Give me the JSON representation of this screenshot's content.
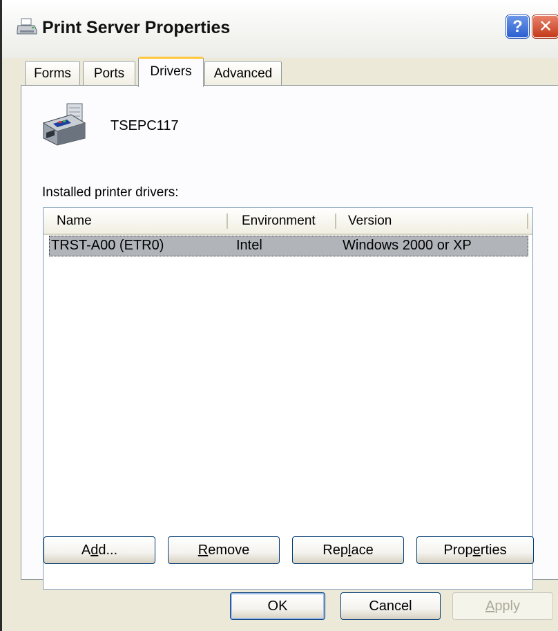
{
  "window": {
    "title": "Print Server Properties",
    "help_label": "?",
    "close_label": "✕",
    "accent": "#2a5fd1",
    "close_color": "#c33a1a"
  },
  "tabs": [
    {
      "label": "Forms",
      "selected": false
    },
    {
      "label": "Ports",
      "selected": false
    },
    {
      "label": "Drivers",
      "selected": true
    },
    {
      "label": "Advanced",
      "selected": false
    }
  ],
  "drivers_page": {
    "server_name": "TSEPC117",
    "installed_label": "Installed printer drivers:",
    "columns": [
      "Name",
      "Environment",
      "Version"
    ],
    "rows": [
      {
        "name": "TRST-A00 (ETR0)",
        "environment": "Intel",
        "version": "Windows 2000 or XP",
        "selected": true
      }
    ],
    "buttons": {
      "add": {
        "pre": "A",
        "key": "d",
        "post": "d..."
      },
      "remove": {
        "pre": "",
        "key": "R",
        "post": "emove"
      },
      "replace": {
        "pre": "Rep",
        "key": "l",
        "post": "ace"
      },
      "properties": {
        "pre": "Prop",
        "key": "e",
        "post": "rties"
      }
    }
  },
  "dialog_buttons": {
    "ok": "OK",
    "cancel": "Cancel",
    "apply": {
      "pre": "",
      "key": "A",
      "post": "pply",
      "enabled": false
    }
  },
  "icons": {
    "title": "printer-server-icon",
    "server": "printer-icon"
  }
}
